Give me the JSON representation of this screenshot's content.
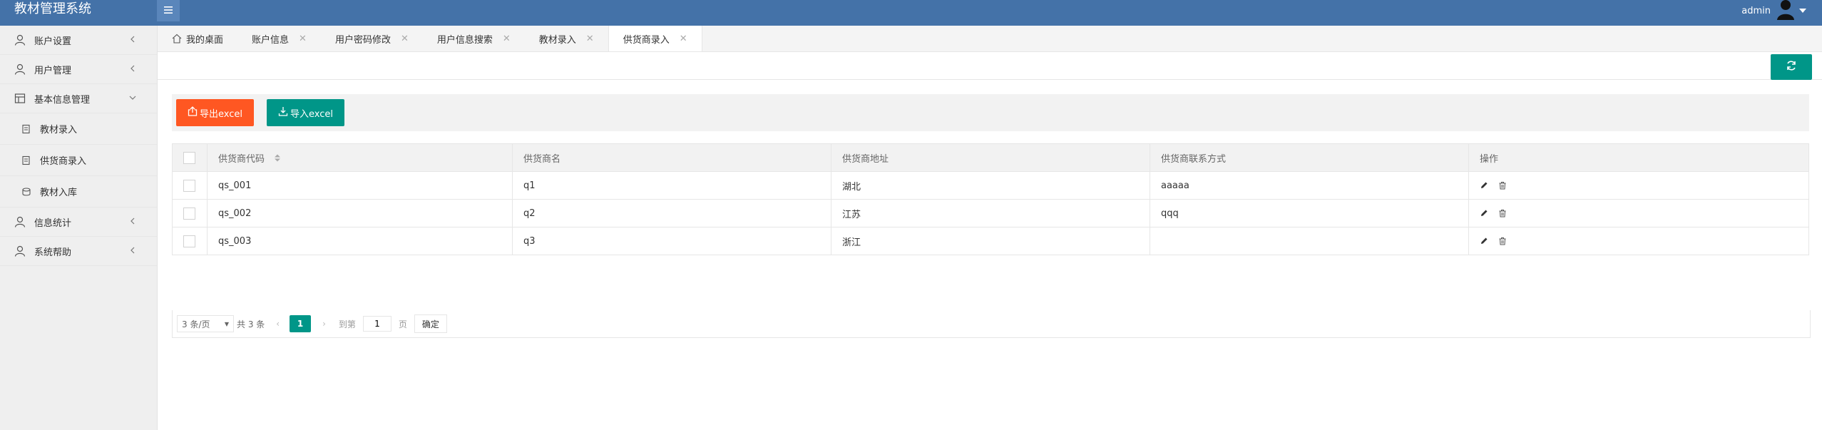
{
  "app": {
    "title": "教材管理系统"
  },
  "header": {
    "user": "admin",
    "icons": {
      "menu": "hamburger-icon",
      "avatar": "user-avatar-icon",
      "caret": "caret-down-icon"
    }
  },
  "colors": {
    "header": "#4472a8",
    "primary": "#009688",
    "danger": "#ff5722",
    "sidebar": "#efefef"
  },
  "sidebar": {
    "items": [
      {
        "label": "账户设置",
        "icon": "user-icon",
        "arrow": "chevron-left"
      },
      {
        "label": "用户管理",
        "icon": "user-icon",
        "arrow": "chevron-left"
      },
      {
        "label": "基本信息管理",
        "icon": "table-icon",
        "arrow": "chevron-down"
      },
      {
        "label": "教材录入",
        "icon": "doc-icon"
      },
      {
        "label": "供货商录入",
        "icon": "doc-icon"
      },
      {
        "label": "教材入库",
        "icon": "box-icon"
      },
      {
        "label": "信息统计",
        "icon": "user-icon",
        "arrow": "chevron-left"
      },
      {
        "label": "系统帮助",
        "icon": "user-icon",
        "arrow": "chevron-left"
      }
    ]
  },
  "tabs": [
    {
      "label": "我的桌面",
      "icon": "home-icon",
      "closable": false
    },
    {
      "label": "账户信息",
      "closable": true
    },
    {
      "label": "用户密码修改",
      "closable": true
    },
    {
      "label": "用户信息搜索",
      "closable": true
    },
    {
      "label": "教材录入",
      "closable": true
    },
    {
      "label": "供货商录入",
      "closable": true,
      "active": true
    }
  ],
  "toolbar": {
    "export_label": "导出excel",
    "import_label": "导入excel"
  },
  "table": {
    "columns": [
      "供货商代码",
      "供货商名",
      "供货商地址",
      "供货商联系方式",
      "操作"
    ],
    "rows": [
      [
        "qs_001",
        "q1",
        "湖北",
        "aaaaa"
      ],
      [
        "qs_002",
        "q2",
        "江苏",
        "qqq"
      ],
      [
        "qs_003",
        "q3",
        "浙江",
        ""
      ]
    ]
  },
  "pagination": {
    "page_size": "3 条/页",
    "total": "共 3 条",
    "current": "1",
    "goto_label": "到第",
    "goto_value": "1",
    "page_label": "页",
    "confirm": "确定"
  }
}
